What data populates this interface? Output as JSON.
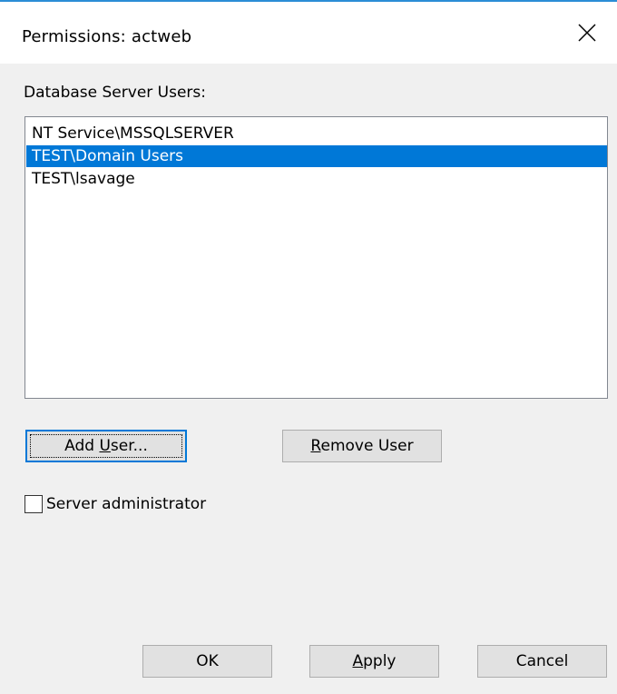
{
  "dialog": {
    "title": "Permissions: actweb",
    "close_icon": "close-icon"
  },
  "users_section": {
    "label": "Database Server Users:",
    "items": [
      {
        "label": "NT Service\\MSSQLSERVER",
        "selected": false
      },
      {
        "label": "TEST\\Domain Users",
        "selected": true
      },
      {
        "label": "TEST\\lsavage",
        "selected": false
      }
    ]
  },
  "buttons": {
    "add_user": {
      "pre": "Add ",
      "mnemonic": "U",
      "post": "ser..."
    },
    "remove_user": {
      "pre": "",
      "mnemonic": "R",
      "post": "emove User"
    },
    "ok": "OK",
    "apply": {
      "pre": "",
      "mnemonic": "A",
      "post": "pply"
    },
    "cancel": "Cancel"
  },
  "server_admin": {
    "label": "Server administrator",
    "checked": false
  },
  "colors": {
    "accent": "#0078d7",
    "title_accent_line": "#2b8dd6",
    "dialog_bg": "#f0f0f0"
  }
}
